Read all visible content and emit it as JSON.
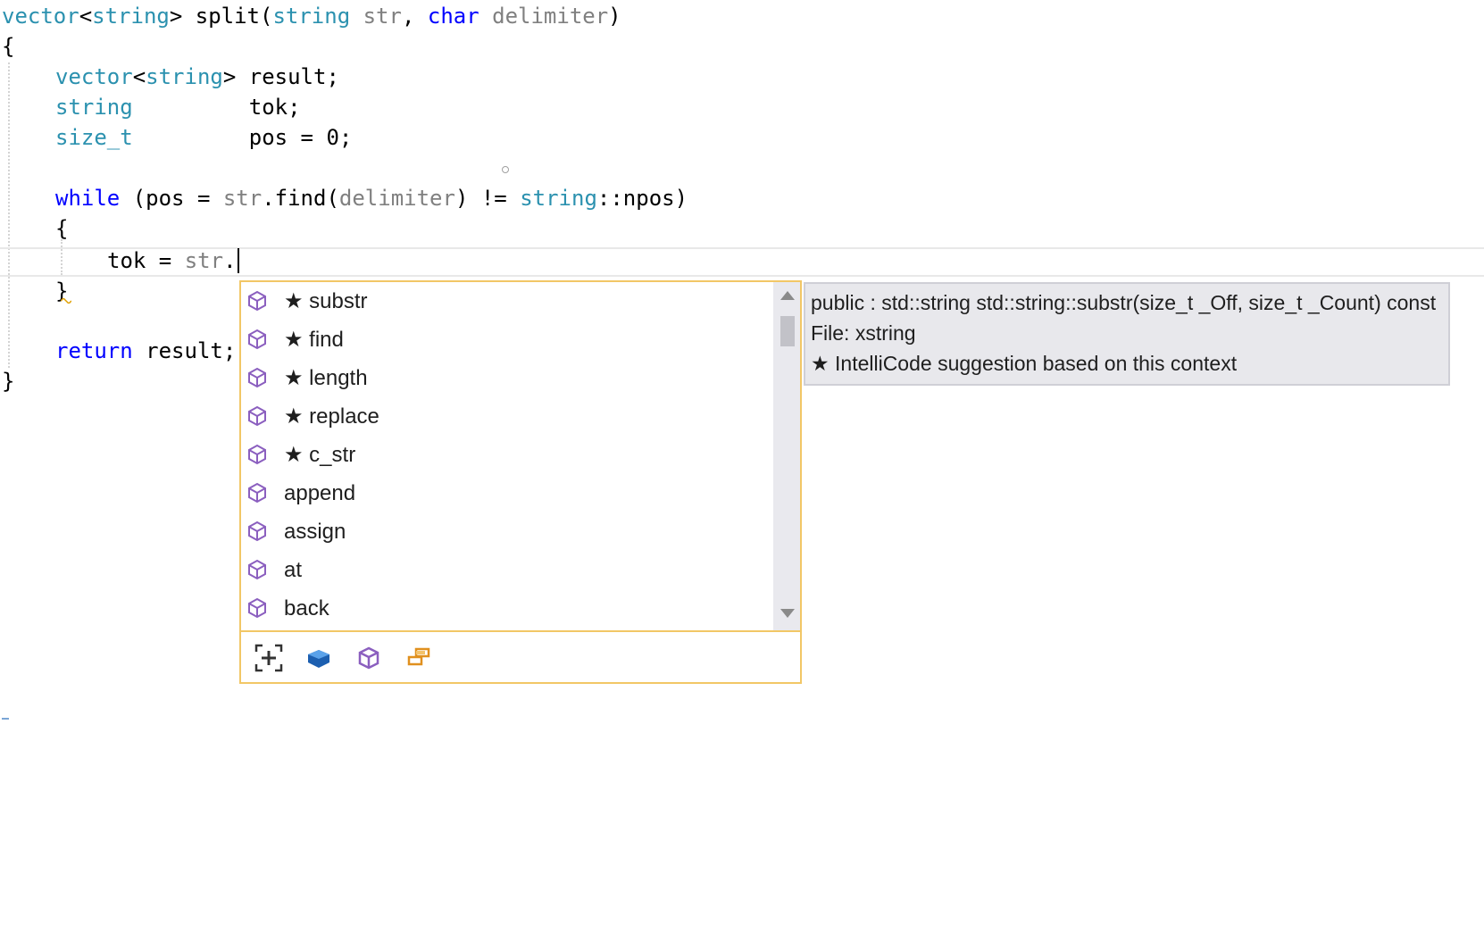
{
  "editor": {
    "lines": [
      {
        "id": "line-1",
        "tokens": [
          {
            "t": "vector",
            "c": "ty"
          },
          {
            "t": "<",
            "c": ""
          },
          {
            "t": "string",
            "c": "ty"
          },
          {
            "t": "> split(",
            "c": ""
          },
          {
            "t": "string",
            "c": "ty"
          },
          {
            "t": " ",
            "c": ""
          },
          {
            "t": "str",
            "c": "pa"
          },
          {
            "t": ", ",
            "c": ""
          },
          {
            "t": "char",
            "c": "kw"
          },
          {
            "t": " ",
            "c": ""
          },
          {
            "t": "delimiter",
            "c": "pa"
          },
          {
            "t": ")",
            "c": ""
          }
        ]
      },
      {
        "id": "line-2",
        "tokens": [
          {
            "t": "{",
            "c": ""
          }
        ]
      },
      {
        "id": "line-3",
        "tokens": [
          {
            "t": "vector",
            "c": "ty"
          },
          {
            "t": "<",
            "c": ""
          },
          {
            "t": "string",
            "c": "ty"
          },
          {
            "t": "> result;",
            "c": ""
          }
        ]
      },
      {
        "id": "line-4",
        "tokens": [
          {
            "t": "string",
            "c": "ty"
          },
          {
            "t": "         tok;",
            "c": ""
          }
        ]
      },
      {
        "id": "line-5",
        "tokens": [
          {
            "t": "size_t",
            "c": "ty"
          },
          {
            "t": "         pos = 0;",
            "c": ""
          }
        ]
      },
      {
        "id": "line-6",
        "tokens": [
          {
            "t": "while",
            "c": "kw"
          },
          {
            "t": " (pos = ",
            "c": ""
          },
          {
            "t": "str",
            "c": "pa"
          },
          {
            "t": ".find(",
            "c": ""
          },
          {
            "t": "delimiter",
            "c": "pa"
          },
          {
            "t": ") != ",
            "c": ""
          },
          {
            "t": "string",
            "c": "ty"
          },
          {
            "t": "::npos)",
            "c": ""
          }
        ]
      },
      {
        "id": "line-7",
        "tokens": [
          {
            "t": "{",
            "c": ""
          }
        ]
      },
      {
        "id": "line-8",
        "tokens": [
          {
            "t": "tok = ",
            "c": ""
          },
          {
            "t": "str",
            "c": "pa"
          },
          {
            "t": ".",
            "c": ""
          }
        ]
      },
      {
        "id": "line-9",
        "tokens": [
          {
            "t": "}",
            "c": ""
          }
        ]
      },
      {
        "id": "line-10",
        "tokens": [
          {
            "t": "return",
            "c": "kw"
          },
          {
            "t": " result;",
            "c": ""
          }
        ]
      },
      {
        "id": "line-11",
        "tokens": [
          {
            "t": "}",
            "c": ""
          }
        ]
      }
    ]
  },
  "completion": {
    "items": [
      {
        "label": "★ substr",
        "selected": true
      },
      {
        "label": "★ find",
        "selected": false
      },
      {
        "label": "★ length",
        "selected": false
      },
      {
        "label": "★ replace",
        "selected": false
      },
      {
        "label": "★ c_str",
        "selected": false
      },
      {
        "label": "append",
        "selected": false
      },
      {
        "label": "assign",
        "selected": false
      },
      {
        "label": "at",
        "selected": false
      },
      {
        "label": "back",
        "selected": false
      }
    ],
    "filters": [
      {
        "name": "expand-filter-icon"
      },
      {
        "name": "class-filter-icon"
      },
      {
        "name": "method-filter-icon"
      },
      {
        "name": "field-filter-icon"
      }
    ]
  },
  "tooltip": {
    "signature": "public : std::string std::string::substr(size_t _Off, size_t _Count) const",
    "file": "File: xstring",
    "note": "★ IntelliCode suggestion based on this context"
  },
  "colors": {
    "keyword": "#0000ff",
    "type": "#2b91af",
    "parameter": "#808080",
    "selection_border": "#1f6fd1",
    "popup_border": "#f2c766",
    "method_icon": "#8b5fbf"
  }
}
